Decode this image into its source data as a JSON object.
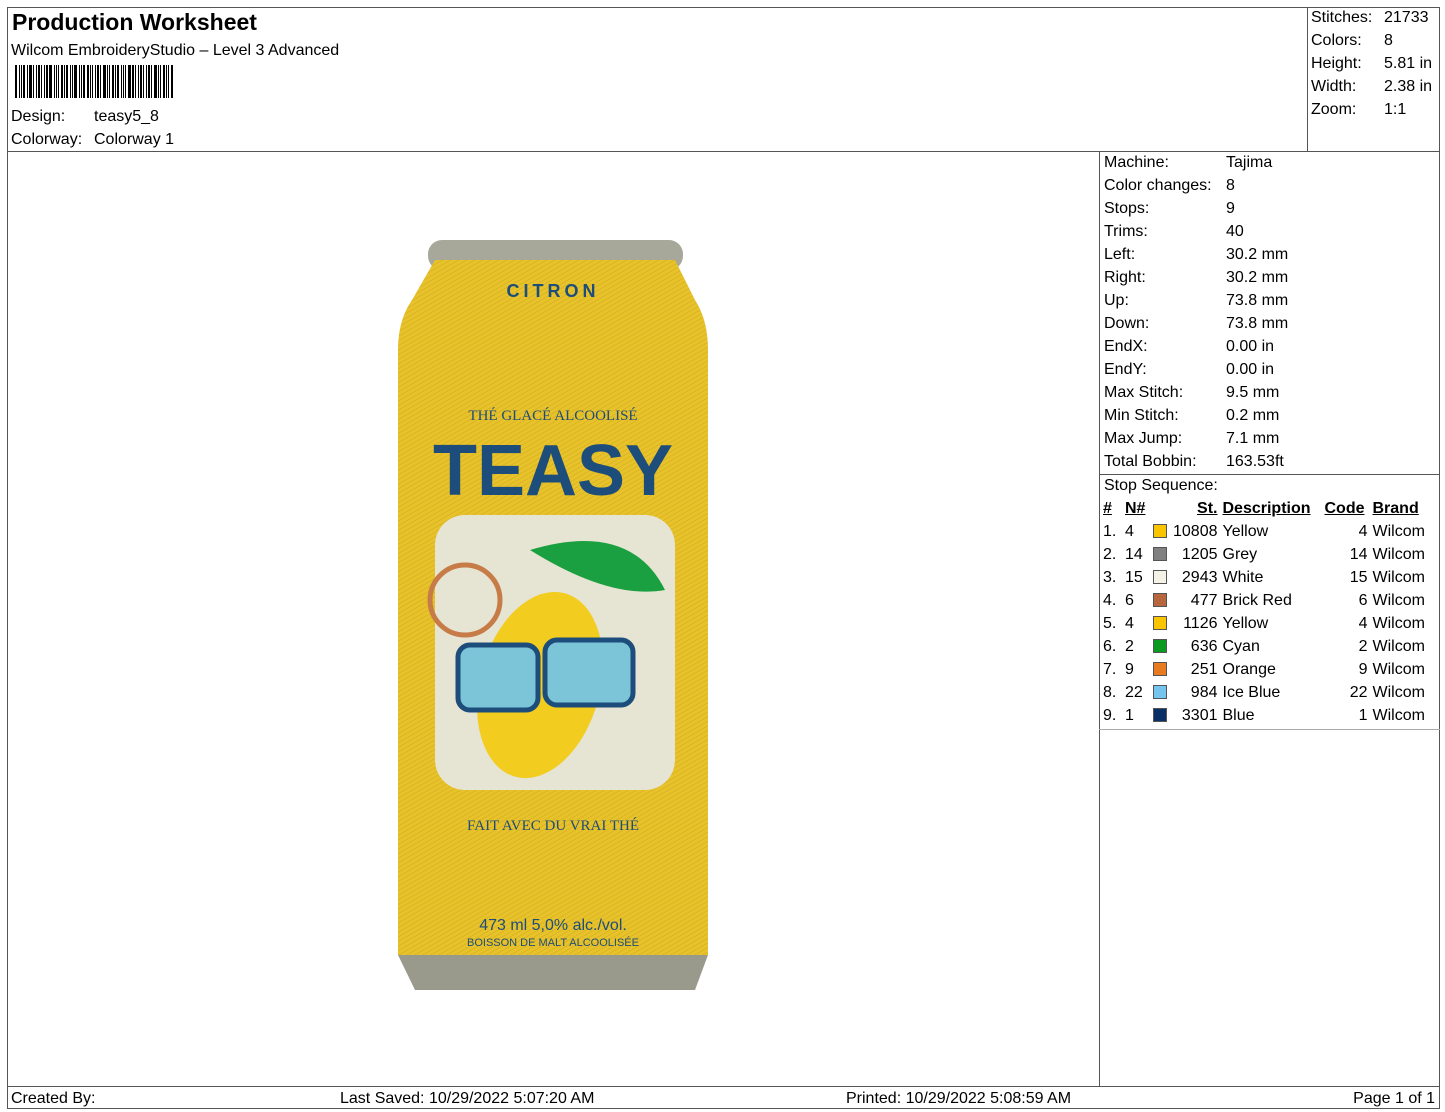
{
  "header": {
    "title": "Production Worksheet",
    "subtitle": "Wilcom EmbroideryStudio – Level 3 Advanced",
    "design_label": "Design:",
    "design_value": "teasy5_8",
    "colorway_label": "Colorway:",
    "colorway_value": "Colorway 1"
  },
  "summary": [
    {
      "label": "Stitches:",
      "value": "21733"
    },
    {
      "label": "Colors:",
      "value": "8"
    },
    {
      "label": "Height:",
      "value": "5.81 in"
    },
    {
      "label": "Width:",
      "value": "2.38 in"
    },
    {
      "label": "Zoom:",
      "value": "1:1"
    }
  ],
  "machine_info": [
    {
      "label": "Machine:",
      "value": "Tajima"
    },
    {
      "label": "Color changes:",
      "value": "8"
    },
    {
      "label": "Stops:",
      "value": "9"
    },
    {
      "label": "Trims:",
      "value": "40"
    },
    {
      "label": "Left:",
      "value": "30.2 mm"
    },
    {
      "label": "Right:",
      "value": "30.2 mm"
    },
    {
      "label": "Up:",
      "value": "73.8 mm"
    },
    {
      "label": "Down:",
      "value": "73.8 mm"
    },
    {
      "label": "EndX:",
      "value": "0.00 in"
    },
    {
      "label": "EndY:",
      "value": "0.00 in"
    },
    {
      "label": "Max Stitch:",
      "value": "9.5 mm"
    },
    {
      "label": "Min Stitch:",
      "value": "0.2 mm"
    },
    {
      "label": "Max Jump:",
      "value": "7.1 mm"
    },
    {
      "label": "Total Bobbin:",
      "value": "163.53ft"
    }
  ],
  "stop_sequence": {
    "label": "Stop Sequence:",
    "headers": {
      "num": "#",
      "n": "N#",
      "st": "St.",
      "desc": "Description",
      "code": "Code",
      "brand": "Brand"
    },
    "rows": [
      {
        "num": "1.",
        "n": "4",
        "color": "#f9c400",
        "st": "10808",
        "desc": "Yellow",
        "code": "4",
        "brand": "Wilcom"
      },
      {
        "num": "2.",
        "n": "14",
        "color": "#808080",
        "st": "1205",
        "desc": "Grey",
        "code": "14",
        "brand": "Wilcom"
      },
      {
        "num": "3.",
        "n": "15",
        "color": "#f5f3e6",
        "st": "2943",
        "desc": "White",
        "code": "15",
        "brand": "Wilcom"
      },
      {
        "num": "4.",
        "n": "6",
        "color": "#b8663e",
        "st": "477",
        "desc": "Brick Red",
        "code": "6",
        "brand": "Wilcom"
      },
      {
        "num": "5.",
        "n": "4",
        "color": "#f9c400",
        "st": "1126",
        "desc": "Yellow",
        "code": "4",
        "brand": "Wilcom"
      },
      {
        "num": "6.",
        "n": "2",
        "color": "#0a9a1e",
        "st": "636",
        "desc": "Cyan",
        "code": "2",
        "brand": "Wilcom"
      },
      {
        "num": "7.",
        "n": "9",
        "color": "#e87a20",
        "st": "251",
        "desc": "Orange",
        "code": "9",
        "brand": "Wilcom"
      },
      {
        "num": "8.",
        "n": "22",
        "color": "#74c4ee",
        "st": "984",
        "desc": "Ice Blue",
        "code": "22",
        "brand": "Wilcom"
      },
      {
        "num": "9.",
        "n": "1",
        "color": "#0a2f66",
        "st": "3301",
        "desc": "Blue",
        "code": "1",
        "brand": "Wilcom"
      }
    ]
  },
  "design_art": {
    "top": "CITRON",
    "arc_top": "THÉ GLACÉ ALCOOLISÉ",
    "brand": "TEASY",
    "arc_bottom": "FAIT AVEC DU VRAI THÉ",
    "volume": "473 ml  5,0% alc./vol.",
    "bottom": "BOISSON DE MALT ALCOOLISÉE"
  },
  "footer": {
    "created": "Created By:",
    "saved": "Last Saved: 10/29/2022 5:07:20 AM",
    "printed": "Printed: 10/29/2022 5:08:59 AM",
    "page": "Page 1 of 1"
  }
}
